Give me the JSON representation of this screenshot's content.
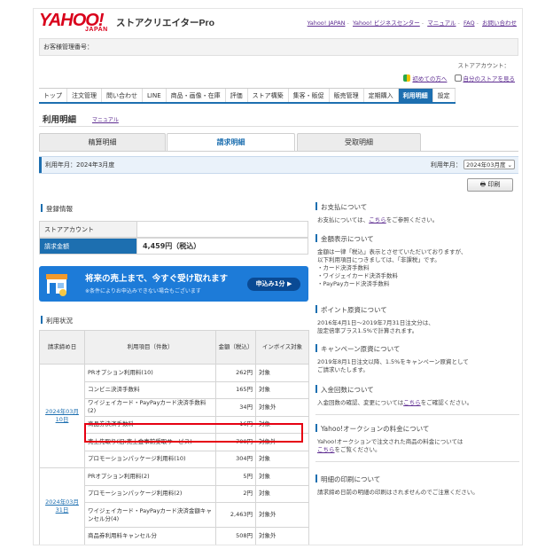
{
  "header": {
    "logo_main": "YAHOO!",
    "logo_sub": "JAPAN",
    "product": "ストアクリエイターPro",
    "links": [
      "Yahoo! JAPAN",
      "Yahoo! ビジネスセンター",
      "マニュアル",
      "FAQ",
      "お問い合わせ"
    ]
  },
  "customer_bar": {
    "label": "お客様管理番号："
  },
  "store_account_label": "ストアアカウント：",
  "help_links": [
    "初めての方へ",
    "自分のストアを見る"
  ],
  "nav": {
    "items": [
      "トップ",
      "注文管理",
      "問い合わせ",
      "LINE",
      "商品・画像・在庫",
      "評価",
      "ストア構築",
      "集客・販促",
      "販売管理",
      "定期購入",
      "利用明細",
      "設定"
    ],
    "active": "利用明細"
  },
  "page_title": "利用明細",
  "manual_link": "マニュアル",
  "tabs": [
    "精算明細",
    "請求明細",
    "受取明細"
  ],
  "active_tab": "請求明細",
  "period": {
    "label": "利用年月：2024年3月度",
    "right_label": "利用年月：",
    "selected": "2024年03月度"
  },
  "print_label": "印刷",
  "registration": {
    "heading": "登録情報",
    "rows": [
      {
        "label": "ストアアカウント",
        "value": ""
      },
      {
        "label": "請求金額",
        "value": "4,459円（税込）"
      }
    ]
  },
  "banner": {
    "main": "将来の売上まで、今すぐ受け取れます",
    "sub": "※条件によりお申込みできない場合もございます",
    "button": "申込み1分 ▶"
  },
  "usage": {
    "heading": "利用状況",
    "headers": [
      "請求締め日",
      "利用項目（件数）",
      "金額（税込）",
      "インボイス対象"
    ],
    "groups": [
      {
        "date": "2024年03月10日",
        "rows": [
          {
            "item": "PRオプション利用料(10)",
            "amount": "262円",
            "invoice": "対象"
          },
          {
            "item": "コンビニ決済手数料",
            "amount": "165円",
            "invoice": "対象"
          },
          {
            "item": "ワイジェイカード・PayPayカード決済手数料(2)",
            "amount": "34円",
            "invoice": "対象外"
          },
          {
            "item": "商品券決済手数料",
            "amount": "16円",
            "invoice": "対象"
          },
          {
            "item": "売上先取り(旧:売上金事前受取サービス)",
            "amount": "700円",
            "invoice": "対象外"
          },
          {
            "item": "プロモーションパッケージ利用料(10)",
            "amount": "304円",
            "invoice": "対象"
          }
        ]
      },
      {
        "date": "2024年03月31日",
        "rows": [
          {
            "item": "PRオプション利用料(2)",
            "amount": "5円",
            "invoice": "対象"
          },
          {
            "item": "プロモーションパッケージ利用料(2)",
            "amount": "2円",
            "invoice": "対象"
          },
          {
            "item": "ワイジェイカード・PayPayカード決済金額キャンセル分(4)",
            "amount": "2,463円",
            "invoice": "対象外"
          },
          {
            "item": "商品券利用料キャンセル分",
            "amount": "508円",
            "invoice": "対象外"
          }
        ]
      }
    ]
  },
  "right": {
    "payment": {
      "heading": "お支払について",
      "pre": "お支払については、",
      "link": "こちら",
      "post": "をご参照ください。"
    },
    "amount_display": {
      "heading": "金額表示について",
      "lines": [
        "金額は一律「税込」表示とさせていただいておりますが、",
        "以下利用項目につきましては、「非課税」です。",
        "・カード決済手数料",
        "・ワイジェイカード決済手数料",
        "・PayPayカード決済手数料"
      ]
    },
    "points": {
      "heading": "ポイント原資について",
      "lines": [
        "2016年4月1日～2019年7月31日注文分は、",
        "設定倍率プラス1.5%で計算されます。"
      ]
    },
    "campaign": {
      "heading": "キャンペーン原資について",
      "lines": [
        "2019年8月1日注文以降、1.5%をキャンペーン原資として",
        "ご請求いたします。"
      ]
    },
    "deposit": {
      "heading": "入金回数について",
      "pre": "入金回数の確認、変更については",
      "link": "こちら",
      "post": "をご確認ください。"
    },
    "auction": {
      "heading": "Yahoo!オークションの料金について",
      "line1": "Yahoo!オークションで注文された商品の料金については",
      "link": "こちら",
      "post": "をご覧ください。"
    },
    "print_detail": {
      "heading": "明細の印刷について",
      "line": "請求締め日前の明細の印刷はされませんのでご注意ください。"
    }
  },
  "colors": {
    "accent": "#1d6fb0",
    "highlight": "#e60012",
    "brand": "#d9001b",
    "banner": "#1d7bd8"
  }
}
